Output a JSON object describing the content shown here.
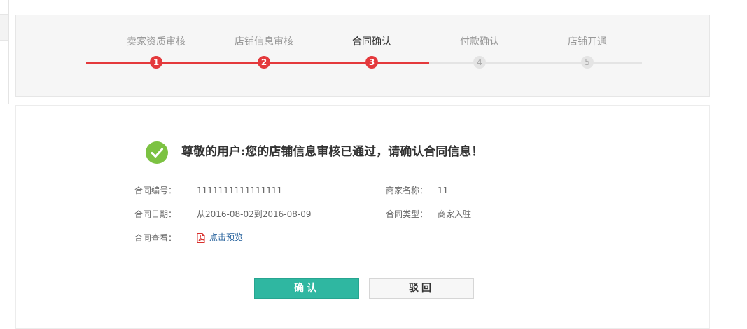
{
  "left_mark": "",
  "steps": [
    {
      "label": "卖家资质审核",
      "num": "1",
      "state": "done"
    },
    {
      "label": "店铺信息审核",
      "num": "2",
      "state": "done"
    },
    {
      "label": "合同确认",
      "num": "3",
      "state": "current"
    },
    {
      "label": "付款确认",
      "num": "4",
      "state": "pending"
    },
    {
      "label": "店铺开通",
      "num": "5",
      "state": "pending"
    }
  ],
  "progress_step": 3,
  "headline": "尊敬的用户:您的店铺信息审核已通过，请确认合同信息！",
  "contract": {
    "number_label": "合同编号：",
    "number_value": "1111111111111111",
    "date_label": "合同日期：",
    "date_value": "从2016-08-02到2016-08-09",
    "view_label": "合同查看：",
    "view_link": "点击预览",
    "merchant_label": "商家名称：",
    "merchant_value": "11",
    "type_label": "合同类型：",
    "type_value": "商家入驻"
  },
  "buttons": {
    "confirm": "确认",
    "reject": "驳回"
  },
  "colors": {
    "accent_red": "#e4393c",
    "success_green": "#7cc242",
    "confirm_teal": "#2fb7a1",
    "link_blue": "#1f5c99"
  },
  "icons": {
    "success": "check-circle-icon",
    "document": "pdf-icon"
  }
}
